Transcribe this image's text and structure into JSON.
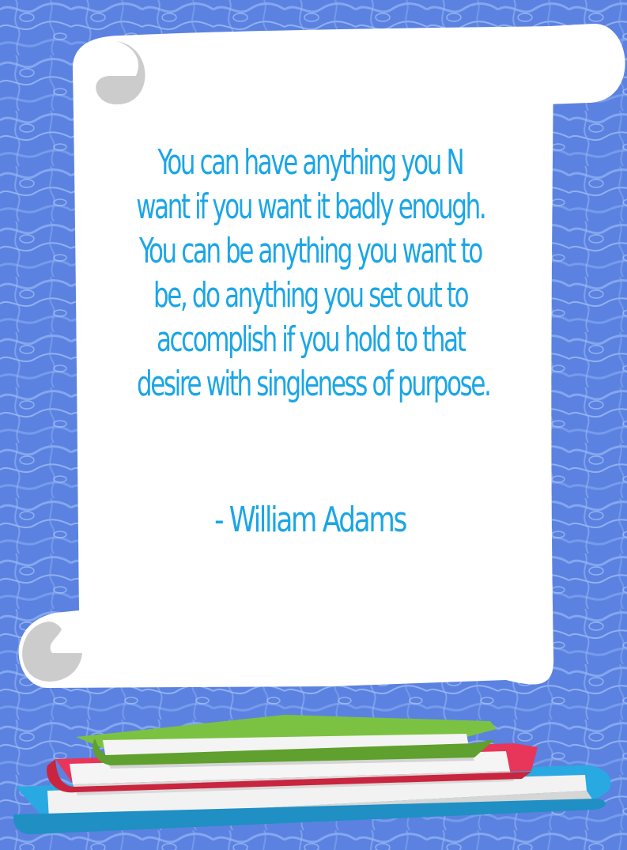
{
  "quote": {
    "lines": [
      "You can have anything you N",
      "want if you want it badly enough.",
      "You can be anything you want to",
      "be, do anything you set out to",
      "accomplish if you hold to that",
      "desire with singleness of purpose."
    ],
    "author": "- William Adams"
  },
  "colors": {
    "background": "#5b82e0",
    "scroll": "#ffffff",
    "scroll_curl": "#cccccc",
    "text": "#1aa6e6",
    "book_top": "#7cc242",
    "book_middle": "#e8365a",
    "book_bottom": "#29a9e1"
  }
}
